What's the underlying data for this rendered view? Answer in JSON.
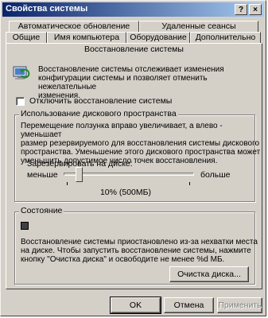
{
  "window": {
    "title": "Свойства системы",
    "help_glyph": "?",
    "close_glyph": "×"
  },
  "tabs": {
    "row1": [
      "Автоматическое обновление",
      "Удаленные сеансы"
    ],
    "row2": [
      "Общие",
      "Имя компьютера",
      "Оборудование",
      "Дополнительно"
    ],
    "active": "Восстановление системы"
  },
  "intro": {
    "text_lines": [
      "Восстановление системы отслеживает изменения",
      "конфигурации системы и позволяет отменить нежелательные",
      "изменения."
    ],
    "icon": "system-restore-icon"
  },
  "disable_checkbox": {
    "label": "Отключить восстановление системы",
    "checked": false
  },
  "disk_usage": {
    "legend": "Использование дискового пространства",
    "description_lines": [
      "Перемещение ползунка вправо увеличивает, а влево - уменьшает",
      "размер резервируемого для восстановления системы дискового",
      "пространства. Уменьшение этого дискового пространства может",
      "уменьшить допустимое число точек восстановления."
    ],
    "slider_label": "Зарезервировать на диске:",
    "min_label": "меньше",
    "max_label": "больше",
    "value_fraction": 0.1,
    "value_text": "10% (500МБ)"
  },
  "status": {
    "legend": "Состояние",
    "icon": "status-stop-icon",
    "text_lines": [
      "Восстановление системы приостановлено из-за нехватки места",
      "на диске. Чтобы запустить восстановление системы, нажмите",
      "кнопку \"Очистка диска\" и освободите не менее %d МБ."
    ],
    "cleanup_button": "Очистка диска..."
  },
  "buttons": {
    "ok": "OK",
    "cancel": "Отмена",
    "apply": "Применить"
  }
}
